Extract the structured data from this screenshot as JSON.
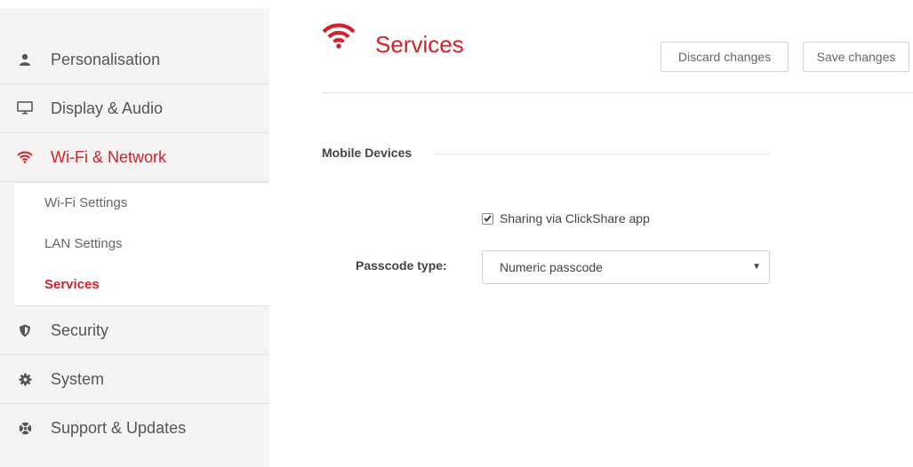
{
  "sidebar": {
    "items": [
      {
        "label": "Personalisation",
        "icon": "user-icon"
      },
      {
        "label": "Display & Audio",
        "icon": "monitor-icon"
      },
      {
        "label": "Wi-Fi & Network",
        "icon": "wifi-icon"
      },
      {
        "label": "Security",
        "icon": "shield-icon"
      },
      {
        "label": "System",
        "icon": "gear-icon"
      },
      {
        "label": "Support & Updates",
        "icon": "lifebuoy-icon"
      }
    ],
    "subitems": [
      {
        "label": "Wi-Fi Settings"
      },
      {
        "label": "LAN Settings"
      },
      {
        "label": "Services"
      }
    ],
    "active_item": "Wi-Fi & Network",
    "active_subitem": "Services"
  },
  "header": {
    "title": "Services",
    "icon": "wifi-icon",
    "discard_label": "Discard changes",
    "save_label": "Save changes"
  },
  "section": {
    "title": "Mobile Devices",
    "sharing_label": "Sharing via ClickShare app",
    "sharing_checked": true,
    "passcode_label": "Passcode type:",
    "passcode_value": "Numeric passcode"
  },
  "colors": {
    "accent": "#d71f26",
    "sidebar_bg": "#f4f4f4"
  }
}
